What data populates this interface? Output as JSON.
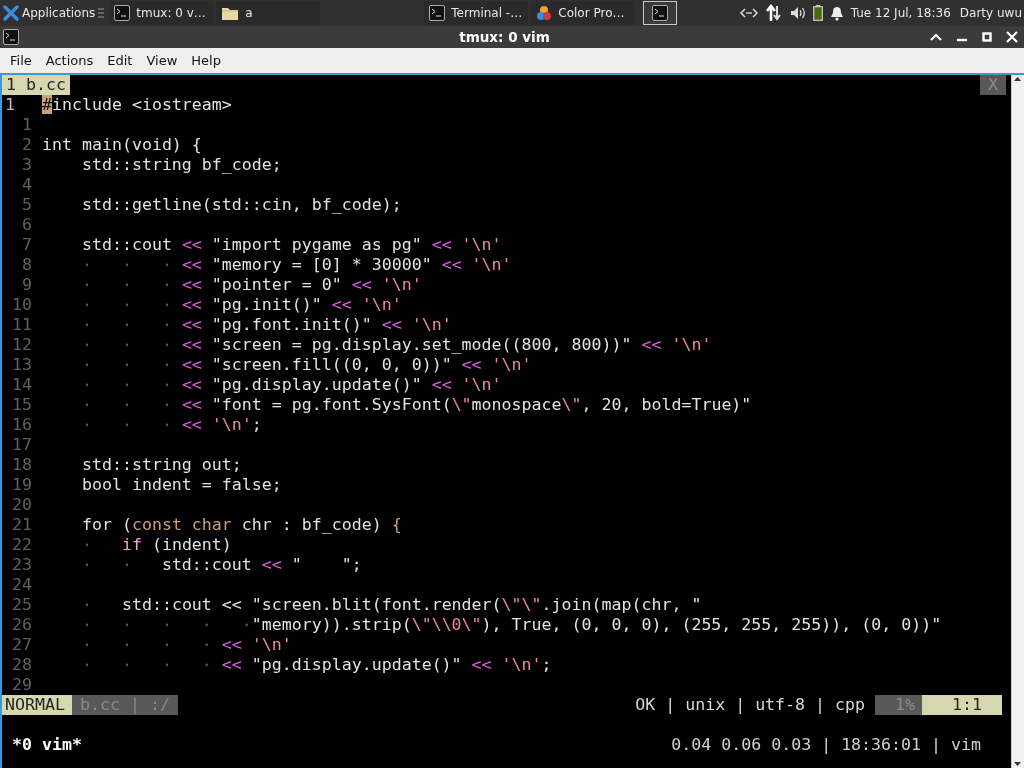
{
  "panel": {
    "apps_label": "Applications",
    "tasks": [
      {
        "label": "tmux: 0 v…",
        "kind": "terminal",
        "selected": false
      },
      {
        "label": "a",
        "kind": "folder",
        "selected": false
      },
      {
        "label": "Terminal -…",
        "kind": "terminal",
        "selected": false
      },
      {
        "label": "Color Pro…",
        "kind": "color",
        "selected": false
      },
      {
        "kind": "terminal",
        "selected": true
      }
    ],
    "clock": "Tue 12 Jul, 18:36",
    "user": "Darty uwu"
  },
  "window": {
    "title": "tmux: 0 vim"
  },
  "menu": [
    "File",
    "Actions",
    "Edit",
    "View",
    "Help"
  ],
  "vim": {
    "tabs": [
      {
        "label": "1 b.cc",
        "selected": true
      }
    ],
    "close_label": "X",
    "lines": [
      {
        "number": "1",
        "current": true,
        "tokens": [
          {
            "kind": "cursor",
            "text": "#"
          },
          {
            "kind": "text",
            "text": "include <iostream>"
          }
        ]
      },
      {
        "number": "1",
        "current": false
      },
      {
        "number": "2",
        "current": false,
        "tokens": [
          {
            "kind": "text",
            "text": "int main(void) {"
          }
        ]
      },
      {
        "number": "3",
        "current": false,
        "tokens": [
          {
            "kind": "text",
            "text": "    std::string bf_code;"
          }
        ]
      },
      {
        "number": "4",
        "current": false
      },
      {
        "number": "5",
        "current": false,
        "tokens": [
          {
            "kind": "text",
            "text": "    std::getline(std::cin, bf_code);"
          }
        ]
      },
      {
        "number": "6",
        "current": false
      },
      {
        "number": "7",
        "current": false,
        "tokens": [
          {
            "kind": "text",
            "text": "    std::cout "
          },
          {
            "kind": "op",
            "text": "<<"
          },
          {
            "kind": "text",
            "text": " \"import pygame as pg\" "
          },
          {
            "kind": "op",
            "text": "<<"
          },
          {
            "kind": "char",
            "text": " '\\n'"
          }
        ]
      },
      {
        "number": "8",
        "current": false,
        "tokens": [
          {
            "kind": "guide",
            "text": "    ·   ·   · "
          },
          {
            "kind": "op",
            "text": "<<"
          },
          {
            "kind": "text",
            "text": " \"memory = [0] * 30000\" "
          },
          {
            "kind": "op",
            "text": "<<"
          },
          {
            "kind": "char",
            "text": " '\\n'"
          }
        ]
      },
      {
        "number": "9",
        "current": false,
        "tokens": [
          {
            "kind": "guide",
            "text": "    ·   ·   · "
          },
          {
            "kind": "op",
            "text": "<<"
          },
          {
            "kind": "text",
            "text": " \"pointer = 0\" "
          },
          {
            "kind": "op",
            "text": "<<"
          },
          {
            "kind": "char",
            "text": " '\\n'"
          }
        ]
      },
      {
        "number": "10",
        "current": false,
        "tokens": [
          {
            "kind": "guide",
            "text": "    ·   ·   · "
          },
          {
            "kind": "op",
            "text": "<<"
          },
          {
            "kind": "text",
            "text": " \"pg.init()\" "
          },
          {
            "kind": "op",
            "text": "<<"
          },
          {
            "kind": "char",
            "text": " '\\n'"
          }
        ]
      },
      {
        "number": "11",
        "current": false,
        "tokens": [
          {
            "kind": "guide",
            "text": "    ·   ·   · "
          },
          {
            "kind": "op",
            "text": "<<"
          },
          {
            "kind": "text",
            "text": " \"pg.font.init()\" "
          },
          {
            "kind": "op",
            "text": "<<"
          },
          {
            "kind": "char",
            "text": " '\\n'"
          }
        ]
      },
      {
        "number": "12",
        "current": false,
        "tokens": [
          {
            "kind": "guide",
            "text": "    ·   ·   · "
          },
          {
            "kind": "op",
            "text": "<<"
          },
          {
            "kind": "text",
            "text": " \"screen = pg.display.set_mode((800, 800))\" "
          },
          {
            "kind": "op",
            "text": "<<"
          },
          {
            "kind": "char",
            "text": " '\\n'"
          }
        ]
      },
      {
        "number": "13",
        "current": false,
        "tokens": [
          {
            "kind": "guide",
            "text": "    ·   ·   · "
          },
          {
            "kind": "op",
            "text": "<<"
          },
          {
            "kind": "text",
            "text": " \"screen.fill((0, 0, 0))\" "
          },
          {
            "kind": "op",
            "text": "<<"
          },
          {
            "kind": "char",
            "text": " '\\n'"
          }
        ]
      },
      {
        "number": "14",
        "current": false,
        "tokens": [
          {
            "kind": "guide",
            "text": "    ·   ·   · "
          },
          {
            "kind": "op",
            "text": "<<"
          },
          {
            "kind": "text",
            "text": " \"pg.display.update()\" "
          },
          {
            "kind": "op",
            "text": "<<"
          },
          {
            "kind": "char",
            "text": " '\\n'"
          }
        ]
      },
      {
        "number": "15",
        "current": false,
        "tokens": [
          {
            "kind": "guide",
            "text": "    ·   ·   · "
          },
          {
            "kind": "op",
            "text": "<<"
          },
          {
            "kind": "text",
            "text": " \"font = pg.font.SysFont("
          },
          {
            "kind": "char",
            "text": "\\\""
          },
          {
            "kind": "text",
            "text": "monospace"
          },
          {
            "kind": "char",
            "text": "\\\""
          },
          {
            "kind": "text",
            "text": ", 20, bold=True)\""
          }
        ]
      },
      {
        "number": "16",
        "current": false,
        "tokens": [
          {
            "kind": "guide",
            "text": "    ·   ·   · "
          },
          {
            "kind": "op",
            "text": "<<"
          },
          {
            "kind": "char",
            "text": " '\\n'"
          },
          {
            "kind": "text",
            "text": ";"
          }
        ]
      },
      {
        "number": "17",
        "current": false
      },
      {
        "number": "18",
        "current": false,
        "tokens": [
          {
            "kind": "text",
            "text": "    std::string out;"
          }
        ]
      },
      {
        "number": "19",
        "current": false,
        "tokens": [
          {
            "kind": "text",
            "text": "    bool indent = false;"
          }
        ]
      },
      {
        "number": "20",
        "current": false
      },
      {
        "number": "21",
        "current": false,
        "tokens": [
          {
            "kind": "text",
            "text": "    for ("
          },
          {
            "kind": "type",
            "text": "const char"
          },
          {
            "kind": "text",
            "text": " chr : bf_code) "
          },
          {
            "kind": "type",
            "text": "{"
          }
        ]
      },
      {
        "number": "22",
        "current": false,
        "tokens": [
          {
            "kind": "guide",
            "text": "    ·   "
          },
          {
            "kind": "keyword",
            "text": "if"
          },
          {
            "kind": "text",
            "text": " (indent)"
          }
        ]
      },
      {
        "number": "23",
        "current": false,
        "tokens": [
          {
            "kind": "guide",
            "text": "    ·   ·   "
          },
          {
            "kind": "text",
            "text": "std::cout "
          },
          {
            "kind": "op",
            "text": "<<"
          },
          {
            "kind": "text",
            "text": " \"    \";"
          }
        ]
      },
      {
        "number": "24",
        "current": false
      },
      {
        "number": "25",
        "current": false,
        "tokens": [
          {
            "kind": "guide",
            "text": "    ·   "
          },
          {
            "kind": "text",
            "text": "std::cout << \"screen.blit(font.render("
          },
          {
            "kind": "char",
            "text": "\\\"\\\""
          },
          {
            "kind": "text",
            "text": ".join(map(chr, \""
          }
        ]
      },
      {
        "number": "26",
        "current": false,
        "tokens": [
          {
            "kind": "guide",
            "text": "    ·   ·   ·   ·   ·"
          },
          {
            "kind": "text",
            "text": "\"memory)).strip("
          },
          {
            "kind": "char",
            "text": "\\\"\\\\0\\\""
          },
          {
            "kind": "text",
            "text": "), True, (0, 0, 0), (255, 255, 255)), (0, 0))\""
          }
        ]
      },
      {
        "number": "27",
        "current": false,
        "tokens": [
          {
            "kind": "guide",
            "text": "    ·   ·   ·   · "
          },
          {
            "kind": "op",
            "text": "<<"
          },
          {
            "kind": "char",
            "text": " '\\n'"
          }
        ]
      },
      {
        "number": "28",
        "current": false,
        "tokens": [
          {
            "kind": "guide",
            "text": "    ·   ·   ·   · "
          },
          {
            "kind": "op",
            "text": "<<"
          },
          {
            "kind": "text",
            "text": " \"pg.display.update()\" "
          },
          {
            "kind": "op",
            "text": "<<"
          },
          {
            "kind": "char",
            "text": " '\\n'"
          },
          {
            "kind": "text",
            "text": ";"
          }
        ]
      },
      {
        "number": "29",
        "current": false
      }
    ],
    "statusline": {
      "mode": "NORMAL",
      "file": "b.cc | :/",
      "info": "OK | unix | utf-8 | cpp",
      "percent": "1%",
      "position": "1:1"
    }
  },
  "tmux": {
    "window_label": "*0 vim*",
    "status": "0.04 0.06 0.03 | 18:36:01 | vim"
  }
}
